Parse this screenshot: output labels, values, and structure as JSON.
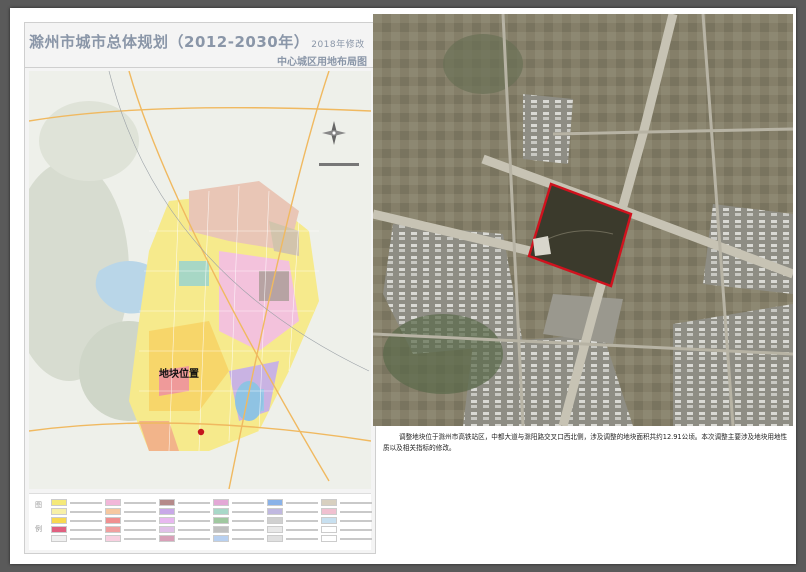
{
  "plan": {
    "title": "滁州市城市总体规划（2012-2030年）",
    "title_note": "2018年修改",
    "subtitle": "中心城区用地布局图",
    "site_label": "地块位置"
  },
  "legend": {
    "colors": [
      "#f5e97a",
      "#f2b7d9",
      "#b58a8a",
      "#e3a8d6",
      "#8ab2e8",
      "#d8d0c0",
      "#f7f0a8",
      "#f6c8a0",
      "#c8a8e8",
      "#a8d8c8",
      "#c0b8e0",
      "#f0c0d0",
      "#f8d850",
      "#f09090",
      "#e8b8f0",
      "#a0c8a0",
      "#d0d0d0",
      "#c8e0f0",
      "#e06080",
      "#f0a0a0",
      "#e0c0e8",
      "#c0c0c0",
      "#e8e8e8",
      "#ffffff",
      "#f0f0f0",
      "#f8d0e0",
      "#d8a0b8",
      "#b8d0f0",
      "#e0e0e0",
      "#ffffff"
    ]
  },
  "satellite": {
    "site_outline_color": "#d0121e"
  },
  "caption": {
    "text": "调整地块位于滁州市高铁站区，中都大道与滁阳路交叉口西北侧，涉及调整的地块面积共约12.91公顷。本次调整主要涉及地块用地性质以及相关指标的修改。"
  }
}
